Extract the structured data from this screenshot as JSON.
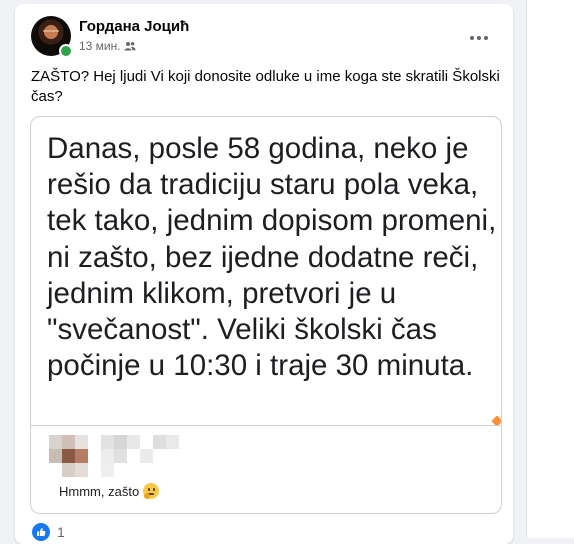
{
  "post": {
    "author": "Гордана Јоцић",
    "time": "13 мин.",
    "audience_icon": "friends-icon",
    "text": "ZAŠTO? Hej ljudi Vi koji donosite odluke u ime koga ste skratili Školski čas?",
    "quote": {
      "text": "Danas, posle 58 godina, neko je rešio da tradiciju staru pola veka, tek tako, jednim dopisom promeni, ni zašto,  bez ijedne dodatne reči, jednim klikom, pretvori je u \"svečanost\". Veliki školski čas počinje u 10:30 i traje 30 minuta.",
      "reply": "Hmmm, zašto",
      "reply_emoji": "thinking-face-icon"
    },
    "reactions": {
      "icon": "like-icon",
      "count": "1"
    }
  },
  "colors": {
    "accent": "#1877f2",
    "online": "#31a24c",
    "page_bg": "#f0f2f5",
    "card_border": "#ced0d4",
    "orange_accent": "#f7923b"
  }
}
